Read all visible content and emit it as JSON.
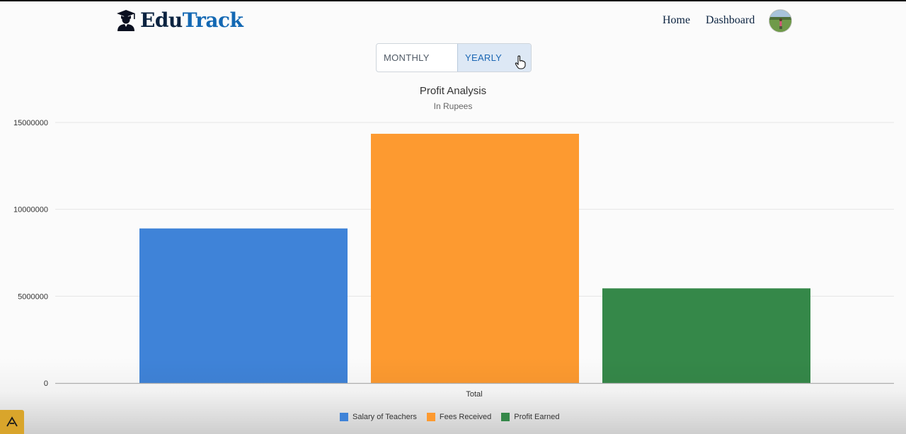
{
  "header": {
    "logo_part1": "Edu",
    "logo_part2": "Track",
    "nav": [
      "Home",
      "Dashboard"
    ]
  },
  "view_toggle": {
    "monthly_label": "MONTHLY VIEW",
    "yearly_label": "YEARLY VIEW",
    "selected": "yearly"
  },
  "chart_data": {
    "type": "bar",
    "title": "Profit Analysis",
    "subtitle": "In Rupees",
    "categories": [
      "Total"
    ],
    "ylim": [
      0,
      15000000
    ],
    "yticks": [
      0,
      5000000,
      10000000,
      15000000
    ],
    "ytick_labels": [
      "0",
      "5000000",
      "10000000",
      "15000000"
    ],
    "grid": true,
    "legend_position": "bottom",
    "series": [
      {
        "name": "Salary of Teachers",
        "values": [
          8900000
        ],
        "color": "#3f83d8"
      },
      {
        "name": "Fees Received",
        "values": [
          14350000
        ],
        "color": "#fd9a30"
      },
      {
        "name": "Profit Earned",
        "values": [
          5450000
        ],
        "color": "#358849"
      }
    ]
  },
  "icons": {
    "logo": "graduate-icon",
    "cursor": "hand-pointer-icon",
    "corner": "app-badge-icon"
  }
}
